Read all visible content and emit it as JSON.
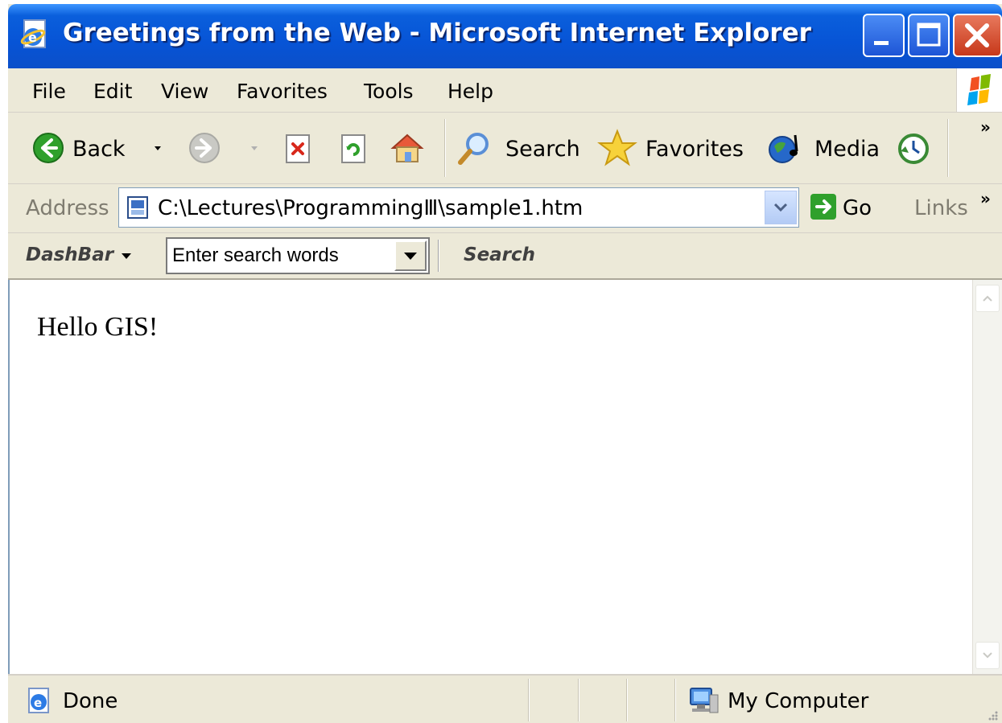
{
  "window": {
    "title": "Greetings from the Web - Microsoft Internet Explorer"
  },
  "menubar": {
    "items": [
      "File",
      "Edit",
      "View",
      "Favorites",
      "Tools",
      "Help"
    ]
  },
  "toolbar": {
    "back_label": "Back",
    "search_label": "Search",
    "favorites_label": "Favorites",
    "media_label": "Media",
    "overflow": "»"
  },
  "addressbar": {
    "label": "Address",
    "url": "C:\\Lectures\\ProgrammingⅢ\\sample1.htm",
    "go_label": "Go",
    "links_label": "Links",
    "overflow": "»"
  },
  "dashbar": {
    "brand": "DashBar",
    "search_value": "Enter search words",
    "search_button": "Search"
  },
  "content": {
    "text": "Hello GIS!"
  },
  "statusbar": {
    "status": "Done",
    "zone": "My Computer"
  },
  "colors": {
    "titlebar": "#0754d6",
    "chrome": "#ece9d8",
    "page": "#ffffff"
  }
}
